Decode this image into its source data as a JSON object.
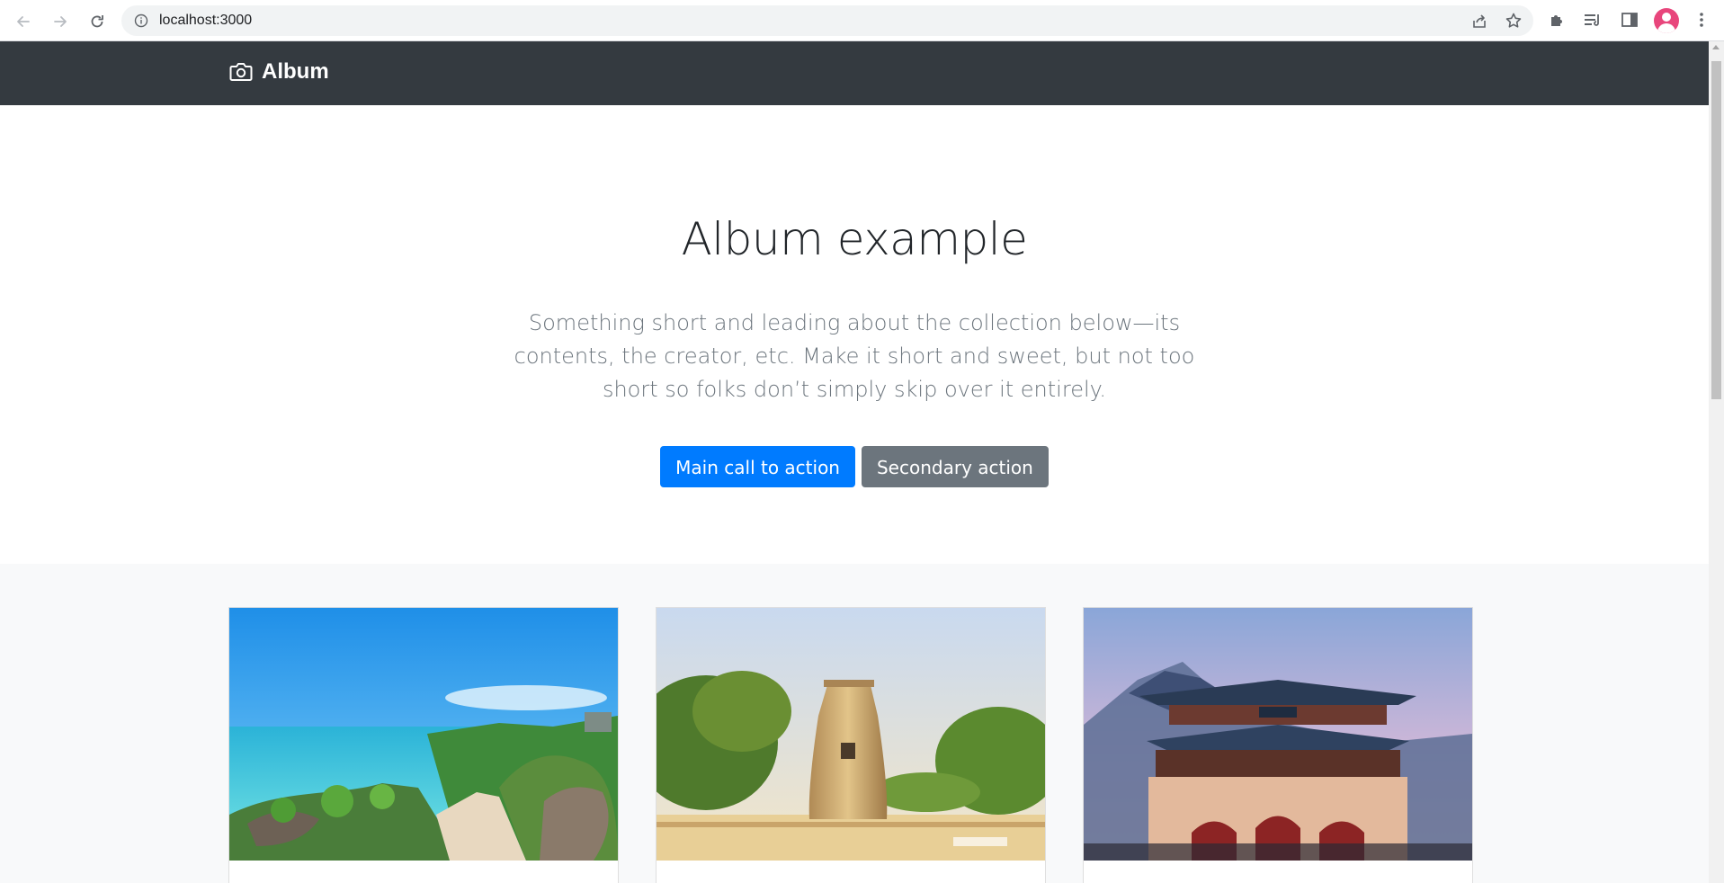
{
  "browser": {
    "url": "localhost:3000"
  },
  "navbar": {
    "brand": "Album",
    "brand_icon": "camera-icon",
    "bg_color": "#343a40"
  },
  "hero": {
    "title": "Album example",
    "lead": "Something short and leading about the collection below—its contents, the creator, etc. Make it short and sweet, but not too short so folks don’t simply skip over it entirely.",
    "primary_button": "Main call to action",
    "secondary_button": "Secondary action"
  },
  "colors": {
    "primary": "#007bff",
    "secondary": "#6c757d",
    "album_bg": "#f8f9fa"
  },
  "album": {
    "cards": [
      {
        "image": "coastal-path-photo"
      },
      {
        "image": "stone-observatory-tower-photo"
      },
      {
        "image": "palace-gate-photo"
      }
    ]
  }
}
